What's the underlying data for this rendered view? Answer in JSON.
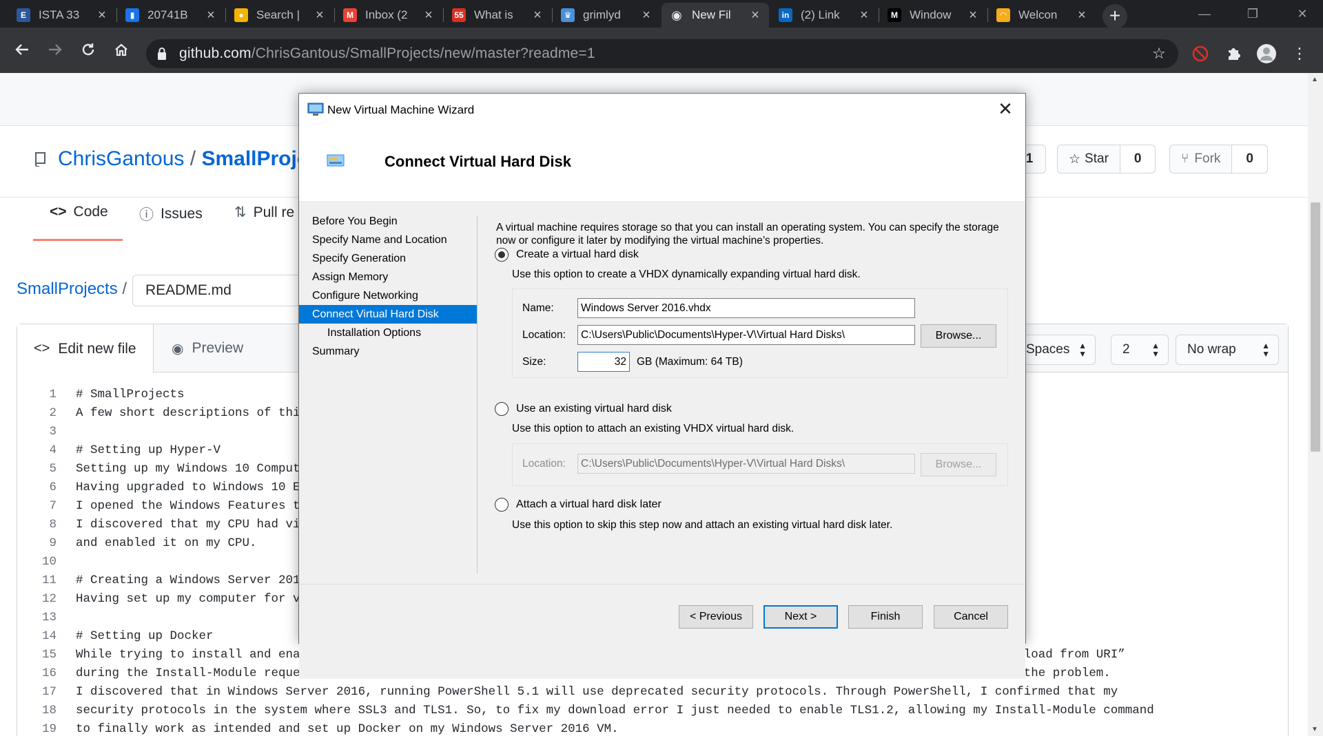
{
  "browser": {
    "tabs": [
      {
        "title": "ISTA 33",
        "favicon": "E",
        "favicon_color": "#2b579a",
        "active": false
      },
      {
        "title": "20741B",
        "favicon": "▮",
        "favicon_color": "#1a73e8",
        "active": false
      },
      {
        "title": "Search |",
        "favicon": "●",
        "favicon_color": "#f4b400",
        "active": false
      },
      {
        "title": "Inbox (2",
        "favicon": "M",
        "favicon_color": "#ea4335",
        "active": false
      },
      {
        "title": "What is",
        "favicon": "55",
        "favicon_color": "#d93025",
        "active": false
      },
      {
        "title": "grimlyd",
        "favicon": "♛",
        "favicon_color": "#4a90d9",
        "active": false
      },
      {
        "title": "New Fil",
        "favicon": "◉",
        "favicon_color": "#e8eaed",
        "active": true
      },
      {
        "title": "(2) Link",
        "favicon": "in",
        "favicon_color": "#0a66c2",
        "active": false
      },
      {
        "title": "Window",
        "favicon": "M",
        "favicon_color": "#000000",
        "active": false
      },
      {
        "title": "Welcon",
        "favicon": "◠",
        "favicon_color": "#f6ad1b",
        "active": false
      }
    ],
    "url_host": "github.com",
    "url_path": "/ChrisGantous/SmallProjects/new/master?readme=1"
  },
  "repo": {
    "owner": "ChrisGantous",
    "separator": "/",
    "name": "SmallProjec",
    "watch_count": "1",
    "star_label": "Star",
    "star_count": "0",
    "fork_label": "Fork",
    "fork_count": "0",
    "nav": {
      "code": "Code",
      "issues": "Issues",
      "pulls": "Pull re"
    }
  },
  "editor": {
    "breadcrumb": "SmallProjects",
    "breadcrumb_sep": "/",
    "filename": "README.md",
    "tab_edit": "Edit new file",
    "tab_preview": "Preview",
    "indent_mode": "Spaces",
    "indent_size": "2",
    "wrap_mode": "No wrap",
    "lines": [
      {
        "n": "1",
        "text": "# SmallProjects"
      },
      {
        "n": "2",
        "text": "A few short descriptions of thing"
      },
      {
        "n": "3",
        "text": ""
      },
      {
        "n": "4",
        "text": "# Setting up Hyper-V"
      },
      {
        "n": "5",
        "text": "Setting up my Windows 10 Computer"
      },
      {
        "n": "6",
        "text": "Having upgraded to Windows 10 Edu"
      },
      {
        "n": "7",
        "text": "I opened the Windows Features to"
      },
      {
        "n": "8",
        "text": "I discovered that my CPU had virt"
      },
      {
        "n": "9",
        "text": "and enabled it on my CPU."
      },
      {
        "n": "10",
        "text": ""
      },
      {
        "n": "11",
        "text": "# Creating a Windows Server 2016"
      },
      {
        "n": "12",
        "text": "Having set up my computer for vir"
      },
      {
        "n": "13",
        "text": ""
      },
      {
        "n": "14",
        "text": "# Setting up Docker"
      },
      {
        "n": "15",
        "text": "While trying to install and enable Docker through PowerShell on my VM I was running getting an error stating it was “Unable to download from URI”"
      },
      {
        "n": "16",
        "text": "during the Install-Module request. After verifying internet connection functionality using ping in PowerShell, I began to research the problem."
      },
      {
        "n": "17",
        "text": "I discovered that in Windows Server 2016, running PowerShell 5.1 will use deprecated security protocols. Through PowerShell, I confirmed that my"
      },
      {
        "n": "18",
        "text": "security protocols in the system where SSL3 and TLS1. So, to fix my download error I just needed to enable TLS1.2, allowing my Install-Module command"
      },
      {
        "n": "19",
        "text": "to finally work as intended and set up Docker on my Windows Server 2016 VM."
      }
    ]
  },
  "wizard": {
    "window_title": "New Virtual Machine Wizard",
    "heading": "Connect Virtual Hard Disk",
    "steps": [
      {
        "label": "Before You Begin",
        "current": false,
        "sub": false
      },
      {
        "label": "Specify Name and Location",
        "current": false,
        "sub": false
      },
      {
        "label": "Specify Generation",
        "current": false,
        "sub": false
      },
      {
        "label": "Assign Memory",
        "current": false,
        "sub": false
      },
      {
        "label": "Configure Networking",
        "current": false,
        "sub": false
      },
      {
        "label": "Connect Virtual Hard Disk",
        "current": true,
        "sub": false
      },
      {
        "label": "Installation Options",
        "current": false,
        "sub": true
      },
      {
        "label": "Summary",
        "current": false,
        "sub": false
      }
    ],
    "intro": "A virtual machine requires storage so that you can install an operating system. You can specify the storage now or configure it later by modifying the virtual machine’s properties.",
    "option_create": {
      "label": "Create a virtual hard disk",
      "selected": true,
      "description": "Use this option to create a VHDX dynamically expanding virtual hard disk.",
      "name_label": "Name:",
      "name_value": "Windows Server 2016.vhdx",
      "location_label": "Location:",
      "location_value": "C:\\Users\\Public\\Documents\\Hyper-V\\Virtual Hard Disks\\",
      "browse_label": "Browse...",
      "size_label": "Size:",
      "size_value": "32",
      "size_suffix": "GB (Maximum: 64 TB)"
    },
    "option_existing": {
      "label": "Use an existing virtual hard disk",
      "selected": false,
      "description": "Use this option to attach an existing VHDX virtual hard disk.",
      "location_label": "Location:",
      "location_value": "C:\\Users\\Public\\Documents\\Hyper-V\\Virtual Hard Disks\\",
      "browse_label": "Browse..."
    },
    "option_later": {
      "label": "Attach a virtual hard disk later",
      "selected": false,
      "description": "Use this option to skip this step now and attach an existing virtual hard disk later."
    },
    "buttons": {
      "previous": "< Previous",
      "next": "Next >",
      "finish": "Finish",
      "cancel": "Cancel"
    }
  }
}
